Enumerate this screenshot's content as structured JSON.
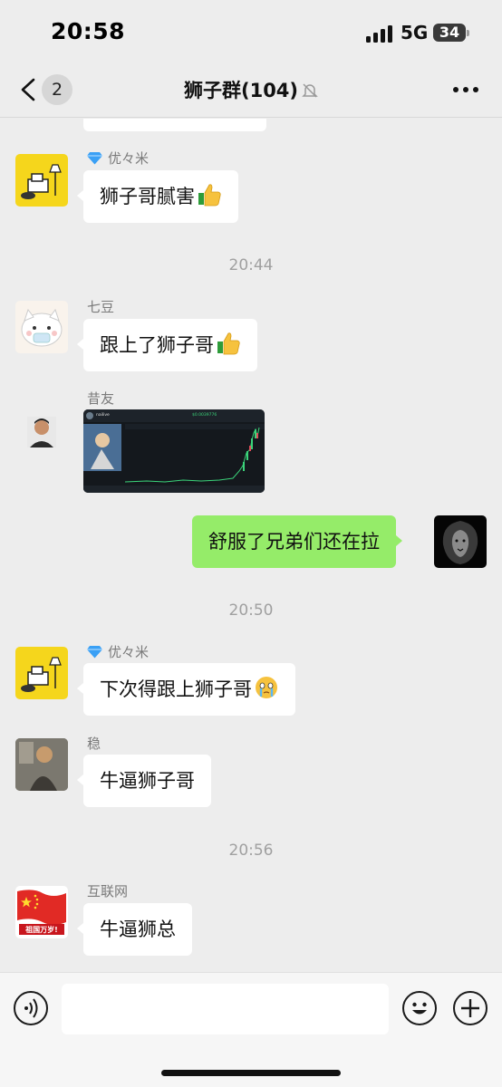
{
  "status_bar": {
    "time": "20:58",
    "network": "5G",
    "battery": "34"
  },
  "nav": {
    "back_badge": "2",
    "title": "狮子群(104)"
  },
  "messages": [
    {
      "type": "text",
      "side": "in",
      "sender": "优々米",
      "sender_badge": "gem-icon",
      "text": "狮子哥腻害",
      "emoji": "thumbs-up-icon"
    },
    {
      "type": "timestamp",
      "text": "20:44"
    },
    {
      "type": "text",
      "side": "in",
      "sender": "七豆",
      "text": "跟上了狮子哥",
      "emoji": "thumbs-up-icon"
    },
    {
      "type": "image",
      "side": "in",
      "sender": "昔友",
      "image": "trading-chart-screenshot",
      "image_text": {
        "ticker": "nailive",
        "price": "$0.0039776"
      }
    },
    {
      "type": "text",
      "side": "out",
      "text": "舒服了兄弟们还在拉"
    },
    {
      "type": "timestamp",
      "text": "20:50"
    },
    {
      "type": "text",
      "side": "in",
      "sender": "优々米",
      "sender_badge": "gem-icon",
      "text": "下次得跟上狮子哥",
      "emoji": "crying-face-icon"
    },
    {
      "type": "text",
      "side": "in",
      "sender": "稳",
      "text": "牛逼狮子哥"
    },
    {
      "type": "timestamp",
      "text": "20:56"
    },
    {
      "type": "text",
      "side": "in",
      "sender": "互联网",
      "text": "牛逼狮总",
      "avatar_text": "祖国万岁!"
    }
  ],
  "colors": {
    "background": "#ededed",
    "incoming_bubble": "#ffffff",
    "outgoing_bubble": "#95ec69",
    "nav_background": "#ededed",
    "input_bar": "#f6f6f6"
  },
  "input_bar": {
    "voice_icon": "voice-icon",
    "emoji_icon": "emoji-icon",
    "plus_icon": "plus-icon"
  }
}
